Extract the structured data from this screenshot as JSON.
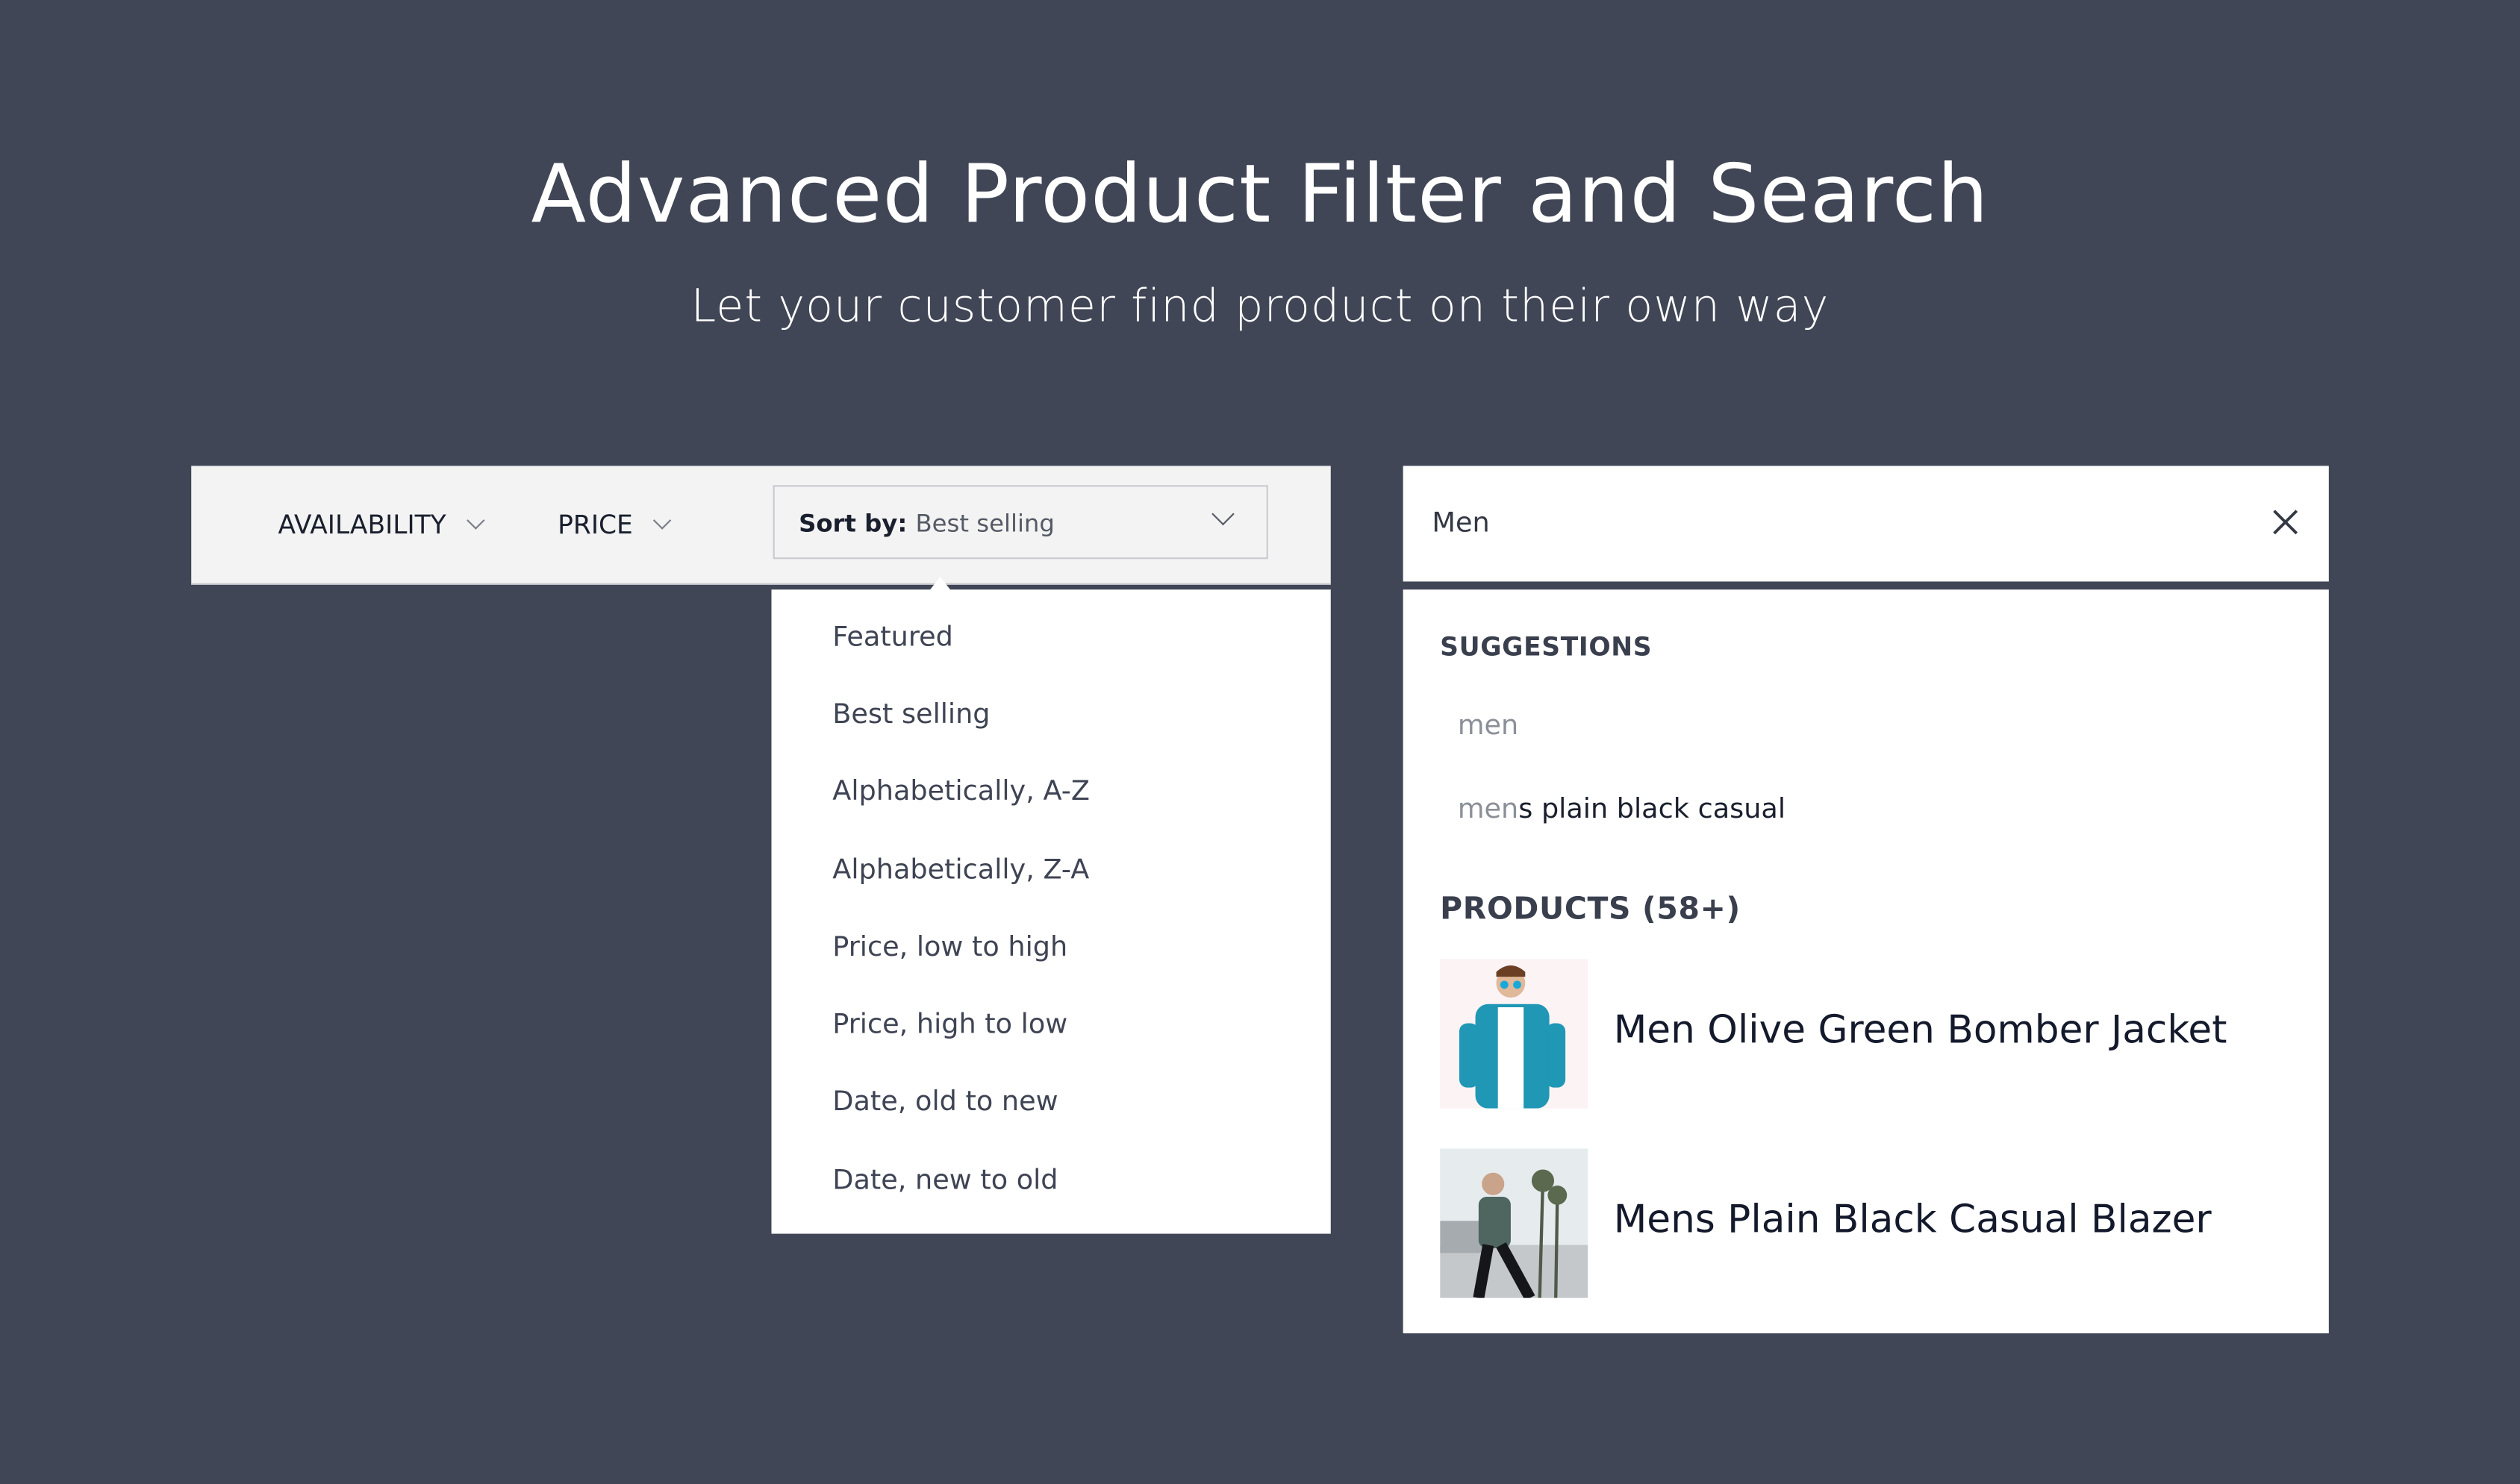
{
  "header": {
    "title": "Advanced Product Filter and Search",
    "subtitle": "Let your customer find product on their own way"
  },
  "filters": {
    "items": [
      {
        "label": "AVAILABILITY",
        "icon": "chevron-down-icon"
      },
      {
        "label": "PRICE",
        "icon": "chevron-down-icon"
      }
    ],
    "sort": {
      "prefix": "Sort by:",
      "selected": "Best selling"
    },
    "sort_options": [
      "Featured",
      "Best selling",
      "Alphabetically, A-Z",
      "Alphabetically, Z-A",
      "Price, low to high",
      "Price, high to low",
      "Date, old to new",
      "Date, new to old"
    ]
  },
  "search": {
    "query": "Men",
    "clear_icon": "close-icon",
    "suggestions_heading": "SUGGESTIONS",
    "suggestions": [
      {
        "match": "men",
        "rest": ""
      },
      {
        "match": "men",
        "rest": "s plain black casual"
      }
    ],
    "products_heading": "PRODUCTS (58+)",
    "products": [
      {
        "title": "Men Olive Green Bomber Jacket"
      },
      {
        "title": "Mens Plain Black Casual Blazer"
      }
    ]
  },
  "colors": {
    "background": "#414656",
    "panel": "#ffffff",
    "filterbar": "#f3f3f3",
    "text": "#141a2c",
    "highlight": "#8b8f98"
  }
}
